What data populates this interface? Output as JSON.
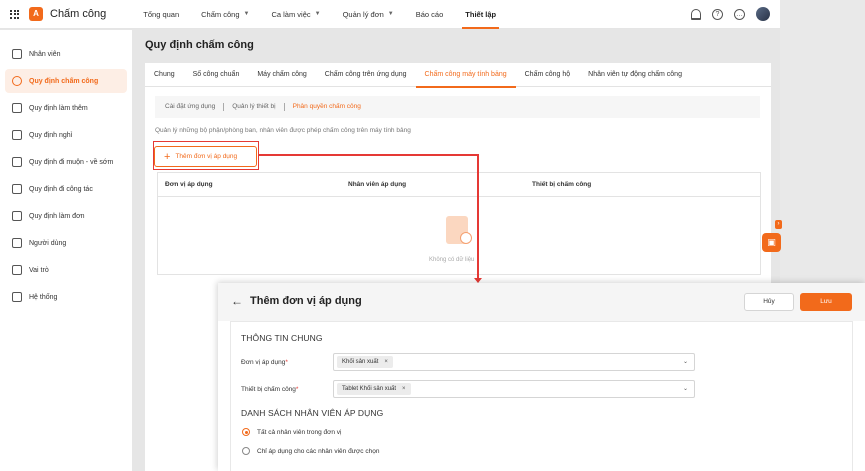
{
  "app": {
    "logo_text": "A",
    "title": "Chấm công"
  },
  "nav": [
    {
      "label": "Tổng quan",
      "dropdown": false
    },
    {
      "label": "Chấm công",
      "dropdown": true
    },
    {
      "label": "Ca làm việc",
      "dropdown": true
    },
    {
      "label": "Quản lý đơn",
      "dropdown": true
    },
    {
      "label": "Báo cáo",
      "dropdown": false
    },
    {
      "label": "Thiết lập",
      "dropdown": false,
      "active": true
    }
  ],
  "topbar_icons": [
    "bell-icon",
    "help-icon",
    "more-icon",
    "avatar"
  ],
  "sidebar": {
    "items": [
      {
        "label": "Nhân viên",
        "icon": "people-icon"
      },
      {
        "label": "Quy định chấm công",
        "icon": "clock-icon",
        "active": true
      },
      {
        "label": "Quy định làm thêm",
        "icon": "overtime-icon"
      },
      {
        "label": "Quy định nghỉ",
        "icon": "calendar-icon"
      },
      {
        "label": "Quy định đi muộn - về sớm",
        "icon": "hourglass-icon"
      },
      {
        "label": "Quy định đi công tác",
        "icon": "briefcase-icon"
      },
      {
        "label": "Quy định làm đơn",
        "icon": "document-icon"
      },
      {
        "label": "Người dùng",
        "icon": "user-icon"
      },
      {
        "label": "Vai trò",
        "icon": "shield-icon"
      },
      {
        "label": "Hệ thống",
        "icon": "system-icon"
      }
    ]
  },
  "page": {
    "title": "Quy định chấm công",
    "tabs": [
      {
        "label": "Chung"
      },
      {
        "label": "Số công chuẩn"
      },
      {
        "label": "Máy chấm công"
      },
      {
        "label": "Chấm công trên ứng dụng"
      },
      {
        "label": "Chấm công máy tính bảng",
        "active": true
      },
      {
        "label": "Chấm công hộ"
      },
      {
        "label": "Nhân viên tự động chấm công"
      }
    ],
    "subtabs": [
      {
        "label": "Cài đặt ứng dụng"
      },
      {
        "label": "Quản lý thiết bị"
      },
      {
        "label": "Phân quyền chấm công",
        "active": true
      }
    ],
    "description": "Quản lý những bộ phận/phòng ban, nhân viên được phép chấm công trên máy tính bảng",
    "add_button": "Thêm đơn vị áp dụng",
    "table": {
      "columns": [
        "Đơn vị áp dụng",
        "Nhân viên áp dụng",
        "Thiết bị chấm công"
      ],
      "empty_text": "Không có dữ liệu"
    }
  },
  "dialog": {
    "title": "Thêm đơn vị áp dụng",
    "cancel_label": "Hủy",
    "save_label": "Lưu",
    "section_general": "THÔNG TIN CHUNG",
    "field_unit": {
      "label": "Đơn vị áp dụng",
      "required_mark": "*",
      "chip": "Khối sản xuất"
    },
    "field_device": {
      "label": "Thiết bị chấm công",
      "required_mark": "*",
      "chip": "Tablet Khối sản xuất"
    },
    "section_employees": "DANH SÁCH NHÂN VIÊN ÁP DỤNG",
    "radio_options": [
      {
        "label": "Tất cả nhân viên trong đơn vị",
        "selected": true
      },
      {
        "label": "Chỉ áp dụng cho các nhân viên được chọn",
        "selected": false
      }
    ]
  },
  "colors": {
    "accent": "#f26a1b",
    "highlight": "#e53935"
  }
}
